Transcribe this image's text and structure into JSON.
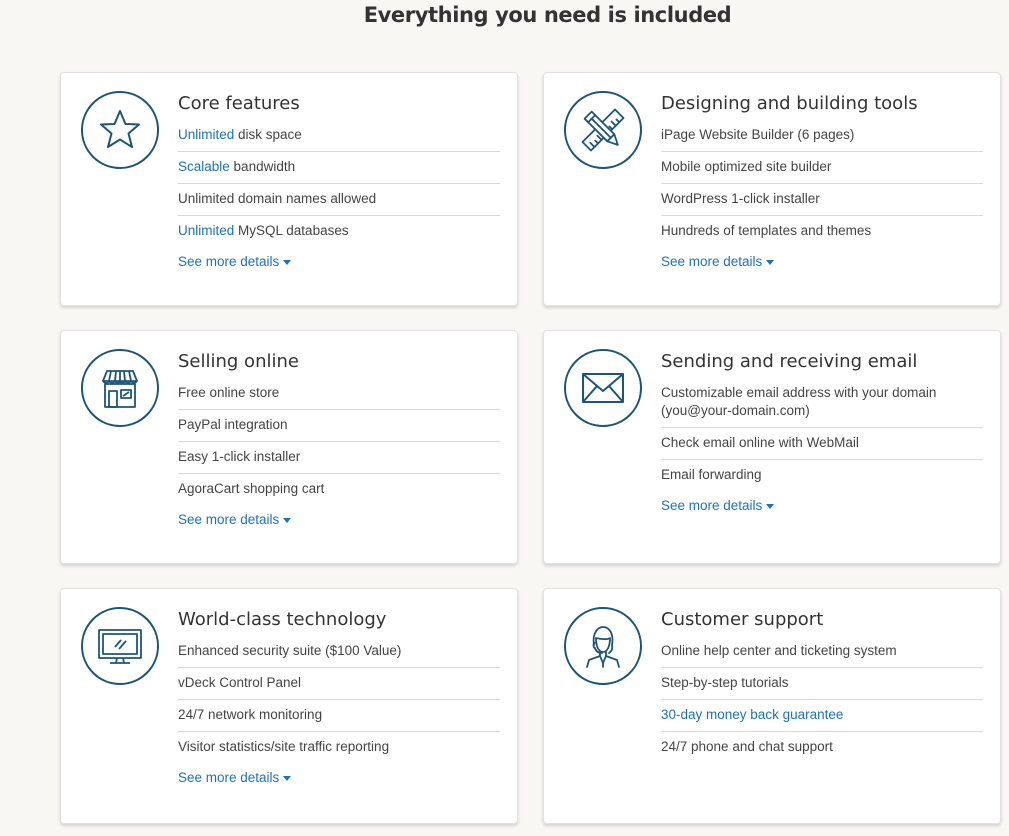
{
  "page_title": "Everything you need is included",
  "colors": {
    "background": "#f8f7f4",
    "icon_stroke": "#1e5577",
    "link": "#1e72b8",
    "text": "#444444"
  },
  "cards": [
    {
      "icon": "star-icon",
      "title": "Core features",
      "items": [
        {
          "highlight": "Unlimited",
          "text": " disk space"
        },
        {
          "highlight": "Scalable",
          "text": " bandwidth"
        },
        {
          "highlight": "",
          "text": "Unlimited domain names allowed"
        },
        {
          "highlight": "Unlimited",
          "text": " MySQL databases"
        }
      ],
      "see_more": "See more details"
    },
    {
      "icon": "pencil-ruler-icon",
      "title": "Designing and building tools",
      "items": [
        {
          "highlight": "",
          "text": "iPage Website Builder (6 pages)"
        },
        {
          "highlight": "",
          "text": "Mobile optimized site builder"
        },
        {
          "highlight": "",
          "text": "WordPress 1-click installer"
        },
        {
          "highlight": "",
          "text": "Hundreds of templates and themes"
        }
      ],
      "see_more": "See more details"
    },
    {
      "icon": "storefront-icon",
      "title": "Selling online",
      "items": [
        {
          "highlight": "",
          "text": "Free online store"
        },
        {
          "highlight": "",
          "text": "PayPal integration"
        },
        {
          "highlight": "",
          "text": "Easy 1-click installer"
        },
        {
          "highlight": "",
          "text": "AgoraCart shopping cart"
        }
      ],
      "see_more": "See more details"
    },
    {
      "icon": "envelope-icon",
      "title": "Sending and receiving email",
      "items": [
        {
          "highlight": "",
          "text": "Customizable email address with your domain (you@your-domain.com)"
        },
        {
          "highlight": "",
          "text": "Check email online with WebMail"
        },
        {
          "highlight": "",
          "text": "Email forwarding"
        }
      ],
      "see_more": "See more details"
    },
    {
      "icon": "monitor-icon",
      "title": "World-class technology",
      "items": [
        {
          "highlight": "",
          "text": "Enhanced security suite ($100 Value)"
        },
        {
          "highlight": "",
          "text": "vDeck Control Panel"
        },
        {
          "highlight": "",
          "text": "24/7 network monitoring"
        },
        {
          "highlight": "",
          "text": "Visitor statistics/site traffic reporting"
        }
      ],
      "see_more": "See more details"
    },
    {
      "icon": "support-agent-icon",
      "title": "Customer support",
      "items": [
        {
          "highlight": "",
          "text": "Online help center and ticketing system"
        },
        {
          "highlight": "",
          "text": "Step-by-step tutorials"
        },
        {
          "link": "30-day money back guarantee"
        },
        {
          "highlight": "",
          "text": "24/7 phone and chat support"
        }
      ]
    }
  ]
}
